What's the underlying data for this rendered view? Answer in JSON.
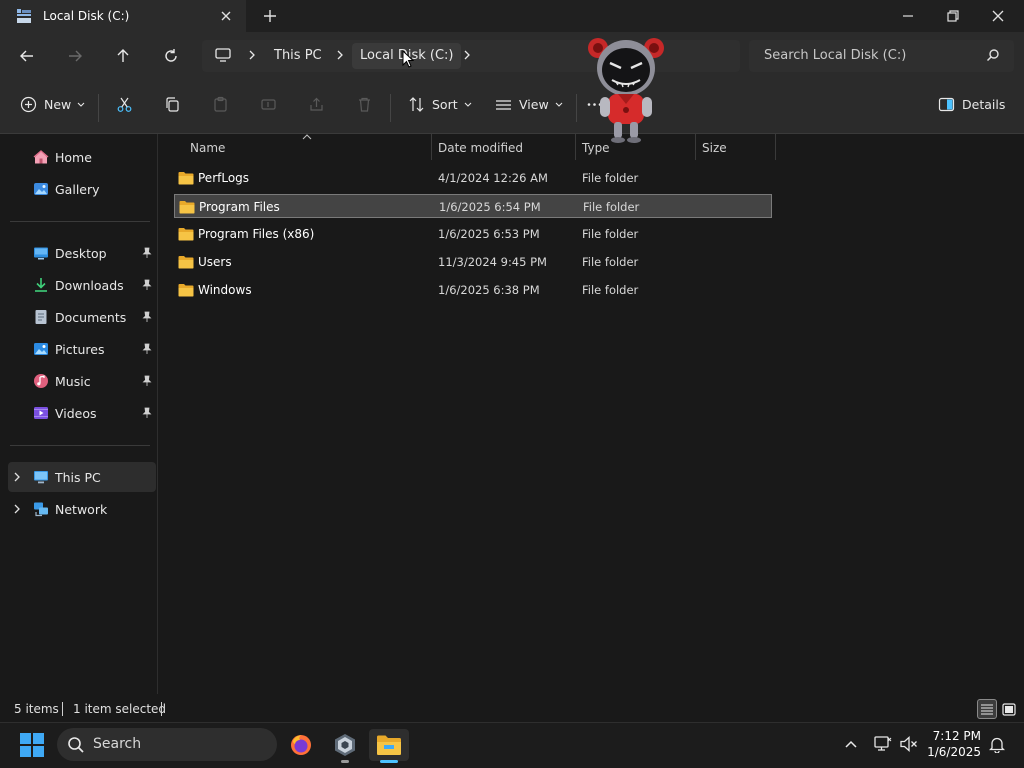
{
  "window": {
    "tab_title": "Local Disk (C:)"
  },
  "address": {
    "crumbs": [
      "This PC",
      "Local Disk (C:)"
    ],
    "search_placeholder": "Search Local Disk (C:)"
  },
  "toolbar": {
    "new_label": "New",
    "sort_label": "Sort",
    "view_label": "View",
    "details_label": "Details"
  },
  "sidebar": {
    "items": [
      {
        "label": "Home",
        "icon": "home-icon"
      },
      {
        "label": "Gallery",
        "icon": "gallery-icon"
      },
      {
        "label": "Desktop",
        "icon": "desktop-icon",
        "pinned": true
      },
      {
        "label": "Downloads",
        "icon": "downloads-icon",
        "pinned": true
      },
      {
        "label": "Documents",
        "icon": "documents-icon",
        "pinned": true
      },
      {
        "label": "Pictures",
        "icon": "pictures-icon",
        "pinned": true
      },
      {
        "label": "Music",
        "icon": "music-icon",
        "pinned": true
      },
      {
        "label": "Videos",
        "icon": "videos-icon",
        "pinned": true
      },
      {
        "label": "This PC",
        "icon": "this-pc-icon",
        "selected": true
      },
      {
        "label": "Network",
        "icon": "network-icon"
      }
    ]
  },
  "filelist": {
    "columns": [
      "Name",
      "Date modified",
      "Type",
      "Size"
    ],
    "rows": [
      {
        "name": "PerfLogs",
        "date": "4/1/2024 12:26 AM",
        "type": "File folder",
        "selected": false
      },
      {
        "name": "Program Files",
        "date": "1/6/2025 6:54 PM",
        "type": "File folder",
        "selected": true
      },
      {
        "name": "Program Files (x86)",
        "date": "1/6/2025 6:53 PM",
        "type": "File folder",
        "selected": false
      },
      {
        "name": "Users",
        "date": "11/3/2024 9:45 PM",
        "type": "File folder",
        "selected": false
      },
      {
        "name": "Windows",
        "date": "1/6/2025 6:38 PM",
        "type": "File folder",
        "selected": false
      }
    ]
  },
  "status": {
    "items_count": "5 items",
    "selection": "1 item selected"
  },
  "taskbar": {
    "search_label": "Search",
    "time": "7:12 PM",
    "date": "1/6/2025"
  },
  "colors": {
    "folder": "#f4c041",
    "accent": "#4cc2ff",
    "selected_row": "#444444"
  }
}
